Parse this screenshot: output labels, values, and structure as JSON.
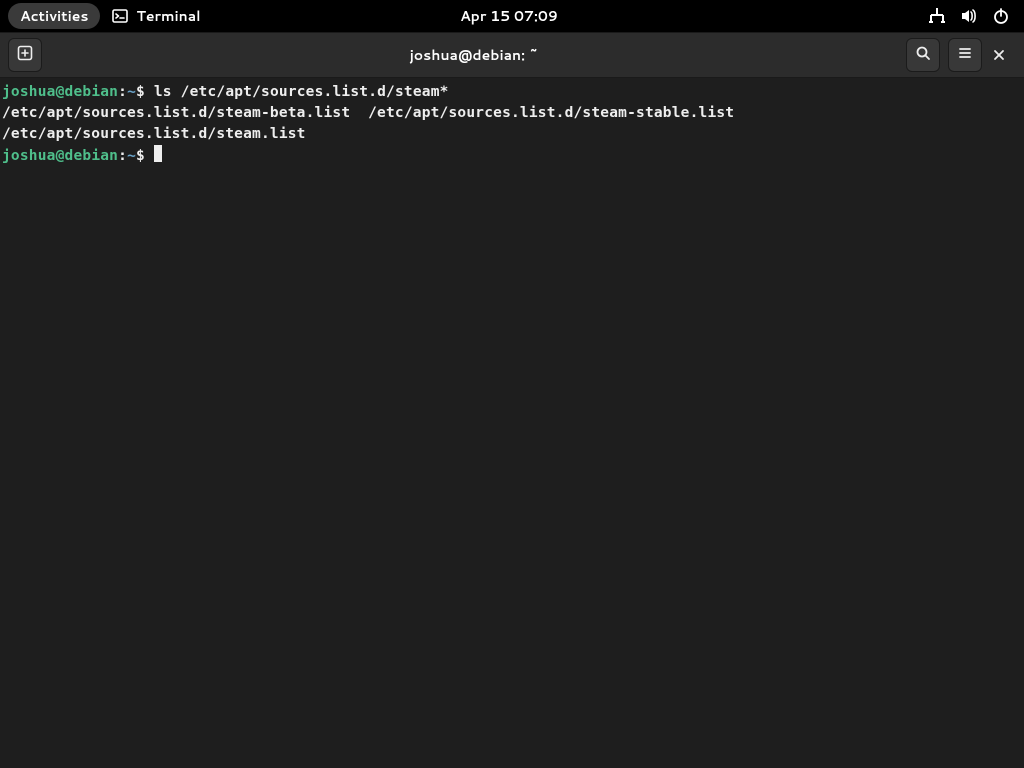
{
  "topbar": {
    "activities_label": "Activities",
    "app_name": "Terminal",
    "datetime": "Apr 15  07:09"
  },
  "window": {
    "title": "joshua@debian: ~"
  },
  "terminal": {
    "prompt1": {
      "user": "joshua",
      "at": "@",
      "host": "debian",
      "sep": ":",
      "path": "~",
      "dollar": "$ ",
      "command": "ls /etc/apt/sources.list.d/steam*"
    },
    "output_line1": "/etc/apt/sources.list.d/steam-beta.list  /etc/apt/sources.list.d/steam-stable.list",
    "output_line2": "/etc/apt/sources.list.d/steam.list",
    "prompt2": {
      "user": "joshua",
      "at": "@",
      "host": "debian",
      "sep": ":",
      "path": "~",
      "dollar": "$ "
    }
  }
}
